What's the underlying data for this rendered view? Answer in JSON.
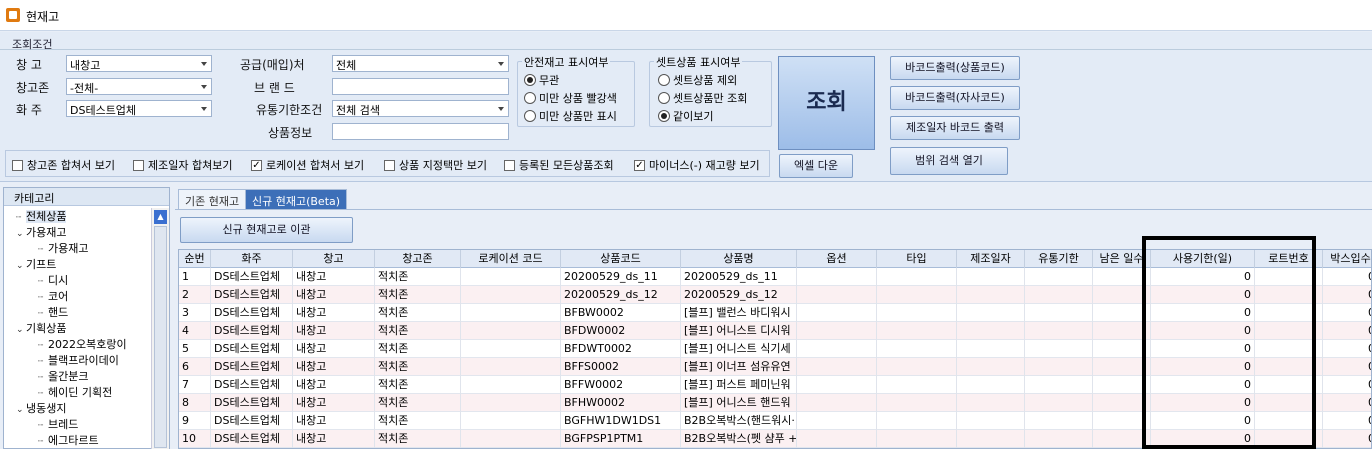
{
  "window": {
    "title": "현재고"
  },
  "conditions": {
    "header": "조회조건",
    "warehouse_label": "창   고",
    "warehouse_value": "내창고",
    "zone_label": "창고존",
    "zone_value": "-전체-",
    "shipper_label": "화   주",
    "shipper_value": "DS테스트업체",
    "supplier_label": "공급(매입)처",
    "supplier_value": "전체",
    "brand_label": "브  랜  드",
    "brand_value": "",
    "expiry_label": "유통기한조건",
    "expiry_value": "전체 검색",
    "product_label": "상품정보",
    "product_value": ""
  },
  "safety_group": {
    "title": "안전재고 표시여부",
    "options": [
      "무관",
      "미만 상품 빨강색",
      "미만 상품만 표시"
    ],
    "selected": 0
  },
  "set_group": {
    "title": "셋트상품 표시여부",
    "options": [
      "셋트상품 제외",
      "셋트상품만 조회",
      "같이보기"
    ],
    "selected": 2
  },
  "checkboxes": [
    {
      "label": "창고존 합쳐서 보기",
      "checked": false
    },
    {
      "label": "제조일자 합쳐보기",
      "checked": false
    },
    {
      "label": "로케이션 합쳐서 보기",
      "checked": true
    },
    {
      "label": "상품 지정택만 보기",
      "checked": false
    },
    {
      "label": "등록된 모든상품조회",
      "checked": false
    },
    {
      "label": "마이너스(-) 재고량 보기",
      "checked": true
    }
  ],
  "buttons": {
    "search": "조회",
    "excel": "엑셀 다운",
    "barcode_product": "바코드출력(상품코드)",
    "barcode_own": "바코드출력(자사코드)",
    "barcode_mfg": "제조일자 바코드 출력",
    "range_search": "범위 검색 열기",
    "move_new": "신규 현재고로 이관"
  },
  "category": {
    "header": "카테고리",
    "items": [
      {
        "label": "전체상품",
        "indent": 1,
        "toggle": ""
      },
      {
        "label": "가용재고",
        "indent": 1,
        "toggle": "v"
      },
      {
        "label": "가용재고",
        "indent": 2,
        "toggle": ""
      },
      {
        "label": "기프트",
        "indent": 1,
        "toggle": "v"
      },
      {
        "label": "디시",
        "indent": 2,
        "toggle": ""
      },
      {
        "label": "코어",
        "indent": 2,
        "toggle": ""
      },
      {
        "label": "핸드",
        "indent": 2,
        "toggle": ""
      },
      {
        "label": "기획상품",
        "indent": 1,
        "toggle": "v"
      },
      {
        "label": "2022오복호랑이",
        "indent": 2,
        "toggle": ""
      },
      {
        "label": "블랙프라이데이",
        "indent": 2,
        "toggle": ""
      },
      {
        "label": "올간분크",
        "indent": 2,
        "toggle": ""
      },
      {
        "label": "헤이딘 기획전",
        "indent": 2,
        "toggle": ""
      },
      {
        "label": "냉동생지",
        "indent": 1,
        "toggle": "v"
      },
      {
        "label": "브레드",
        "indent": 2,
        "toggle": ""
      },
      {
        "label": "에그타르트",
        "indent": 2,
        "toggle": ""
      }
    ]
  },
  "tabs": [
    "기존 현재고",
    "신규 현재고(Beta)"
  ],
  "grid": {
    "columns": [
      "순번",
      "화주",
      "창고",
      "창고존",
      "로케이션 코드",
      "상품코드",
      "상품명",
      "옵션",
      "타입",
      "제조일자",
      "유통기한",
      "남은 일수",
      "사용기한(일)",
      "로트번호",
      "박스입수"
    ],
    "rows": [
      [
        "1",
        "DS테스트업체",
        "내창고",
        "적치존",
        "",
        "20200529_ds_11",
        "20200529_ds_11",
        "",
        "",
        "",
        "",
        "",
        "0",
        "",
        "0"
      ],
      [
        "2",
        "DS테스트업체",
        "내창고",
        "적치존",
        "",
        "20200529_ds_12",
        "20200529_ds_12",
        "",
        "",
        "",
        "",
        "",
        "0",
        "",
        "0"
      ],
      [
        "3",
        "DS테스트업체",
        "내창고",
        "적치존",
        "",
        "BFBW0002",
        "[블프] 밸런스 바디워시",
        "",
        "",
        "",
        "",
        "",
        "0",
        "",
        "0"
      ],
      [
        "4",
        "DS테스트업체",
        "내창고",
        "적치존",
        "",
        "BFDW0002",
        "[블프] 어니스트 디시워",
        "",
        "",
        "",
        "",
        "",
        "0",
        "",
        "0"
      ],
      [
        "5",
        "DS테스트업체",
        "내창고",
        "적치존",
        "",
        "BFDWT0002",
        "[블프] 어니스트 식기세",
        "",
        "",
        "",
        "",
        "",
        "0",
        "",
        "0"
      ],
      [
        "6",
        "DS테스트업체",
        "내창고",
        "적치존",
        "",
        "BFFS0002",
        "[블프] 이너프 섬유유연",
        "",
        "",
        "",
        "",
        "",
        "0",
        "",
        "0"
      ],
      [
        "7",
        "DS테스트업체",
        "내창고",
        "적치존",
        "",
        "BFFW0002",
        "[블프] 퍼스트 페미닌워",
        "",
        "",
        "",
        "",
        "",
        "0",
        "",
        "0"
      ],
      [
        "8",
        "DS테스트업체",
        "내창고",
        "적치존",
        "",
        "BFHW0002",
        "[블프] 어니스트 핸드워",
        "",
        "",
        "",
        "",
        "",
        "0",
        "",
        "0"
      ],
      [
        "9",
        "DS테스트업체",
        "내창고",
        "적치존",
        "",
        "BGFHW1DW1DS1",
        "B2B오복박스(핸드워시·",
        "",
        "",
        "",
        "",
        "",
        "0",
        "",
        "0"
      ],
      [
        "10",
        "DS테스트업체",
        "내창고",
        "적치존",
        "",
        "BGFPSP1PTM1",
        "B2B오복박스(펫 샴푸 +",
        "",
        "",
        "",
        "",
        "",
        "0",
        "",
        "0"
      ]
    ]
  }
}
